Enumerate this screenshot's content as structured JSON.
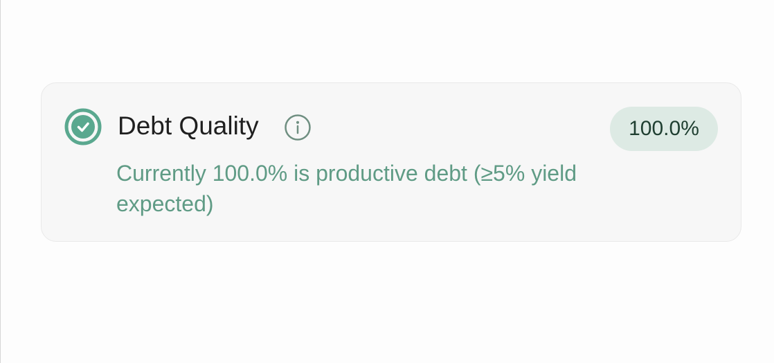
{
  "card": {
    "title": "Debt Quality",
    "badge": "100.0%",
    "description": "Currently 100.0% is productive debt (≥5% yield expected)"
  },
  "icons": {
    "status": "check-circle-icon",
    "info": "info-icon"
  },
  "colors": {
    "accent": "#5aa88f",
    "description_text": "#5f9b85",
    "badge_background": "#ddeae4",
    "card_background": "#f7f7f7"
  }
}
